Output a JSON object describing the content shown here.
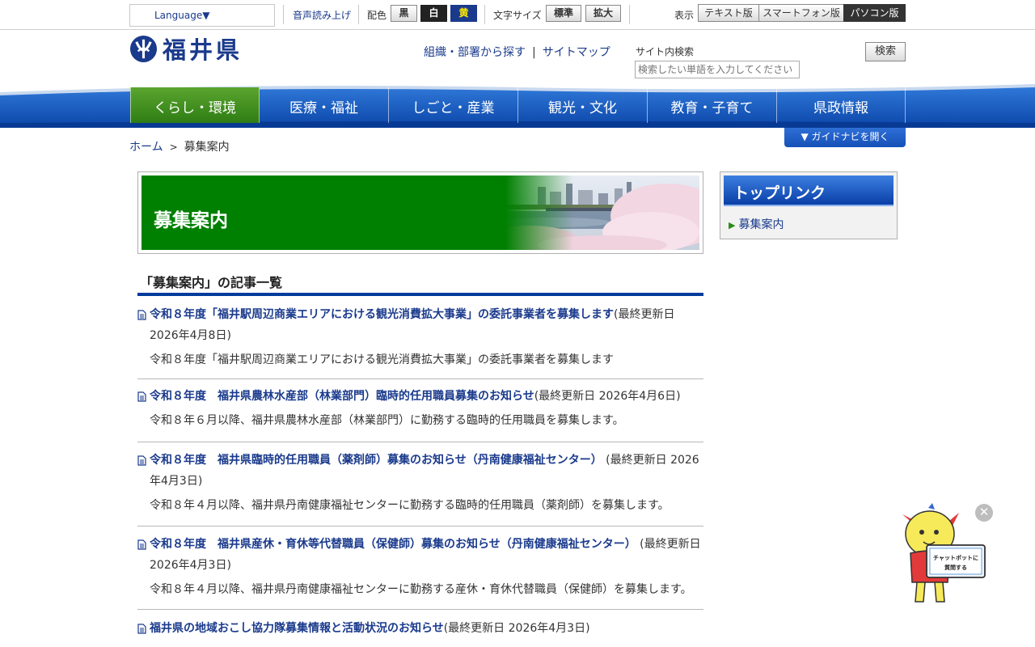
{
  "utility": {
    "language": "Language▼",
    "tts": "音声読み上げ",
    "color_label": "配色",
    "color_black": "黒",
    "color_white": "白",
    "color_yellow": "黄",
    "size_label": "文字サイズ",
    "size_standard": "標準",
    "size_large": "拡大",
    "view_label": "表示",
    "view_text": "テキスト版",
    "view_smartphone": "スマートフォン版",
    "view_pc": "パソコン版"
  },
  "header": {
    "logo_text": "福井県",
    "link_org": "組織・部署から探す",
    "link_separator": "|",
    "link_sitemap": "サイトマップ",
    "search_label": "サイト内検索",
    "search_placeholder": "検索したい単語を入力してください",
    "search_button": "検索"
  },
  "nav": [
    "くらし・環境",
    "医療・福祉",
    "しごと・産業",
    "観光・文化",
    "教育・子育て",
    "県政情報"
  ],
  "breadcrumb": {
    "home": "ホーム",
    "separator": ">",
    "current": "募集案内"
  },
  "guide_nav": "▼ ガイドナビを開く",
  "page_title": "募集案内",
  "list_heading": "「募集案内」の記事一覧",
  "articles": [
    {
      "title": "令和８年度「福井駅周辺商業エリアにおける観光消費拡大事業」の委託事業者を募集します",
      "updated": "(最終更新日 2026年4月8日)",
      "desc": "令和８年度「福井駅周辺商業エリアにおける観光消費拡大事業」の委託事業者を募集します"
    },
    {
      "title": "令和８年度　福井県農林水産部（林業部門）臨時的任用職員募集のお知らせ",
      "updated": "(最終更新日 2026年4月6日)",
      "desc": "令和８年６月以降、福井県農林水産部（林業部門）に勤務する臨時的任用職員を募集します。"
    },
    {
      "title": "令和８年度　福井県臨時的任用職員（薬剤師）募集のお知らせ（丹南健康福祉センター）",
      "updated": " (最終更新日 2026年4月3日)",
      "desc": "令和８年４月以降、福井県丹南健康福祉センターに勤務する臨時的任用職員（薬剤師）を募集します。"
    },
    {
      "title": "令和８年度　福井県産休・育休等代替職員（保健師）募集のお知らせ（丹南健康福祉センター）",
      "updated": " (最終更新日 2026年4月3日)",
      "desc": "令和８年４月以降、福井県丹南健康福祉センターに勤務する産休・育休代替職員（保健師）を募集します。"
    },
    {
      "title": "福井県の地域おこし協力隊募集情報と活動状況のお知らせ",
      "updated": "(最終更新日 2026年4月3日)",
      "desc": ""
    }
  ],
  "sidebar": {
    "heading": "トップリンク",
    "item": "募集案内"
  },
  "chatbot": {
    "sign": "チャットボットに質問する",
    "close": "✕"
  },
  "colors": {
    "brand_blue": "#1a3a8c",
    "nav_blue": "#0a4fb8",
    "active_green": "#3f8f1f",
    "banner_green": "#008000"
  }
}
